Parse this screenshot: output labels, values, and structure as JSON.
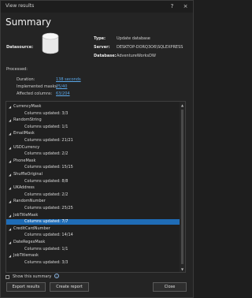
{
  "window": {
    "title": "View results",
    "help_label": "?",
    "close_label": "×"
  },
  "heading": "Summary",
  "datasource": {
    "label": "Datasource:",
    "type_key": "Type:",
    "type_val": "Update database",
    "server_key": "Server:",
    "server_val": "DESKTOP-DORQ3O6\\SQLEXPRESS",
    "database_key": "Database:",
    "database_val": "AdventureWorksDW"
  },
  "processed": {
    "label": "Processed:",
    "stats": [
      {
        "label": "Duration:",
        "value": "138 seconds"
      },
      {
        "label": "Implemented masks:",
        "value": "25/40"
      },
      {
        "label": "Affected columns:",
        "value": "63/204"
      }
    ]
  },
  "tree": {
    "rows": [
      {
        "kind": "group",
        "text": "CurrencyMask"
      },
      {
        "kind": "child",
        "text": "Columns updated: 3/3"
      },
      {
        "kind": "group",
        "text": "RandomString"
      },
      {
        "kind": "child",
        "text": "Columns updated: 1/1"
      },
      {
        "kind": "group",
        "text": "EmailMask"
      },
      {
        "kind": "child",
        "text": "Columns updated: 21/21"
      },
      {
        "kind": "group",
        "text": "USDCurrency"
      },
      {
        "kind": "child",
        "text": "Columns updated: 2/2"
      },
      {
        "kind": "group",
        "text": "PhoneMask"
      },
      {
        "kind": "child",
        "text": "Columns updated: 15/15"
      },
      {
        "kind": "group",
        "text": "ShuffleOriginal"
      },
      {
        "kind": "child",
        "text": "Columns updated: 8/8"
      },
      {
        "kind": "group",
        "text": "UKAddress"
      },
      {
        "kind": "child",
        "text": "Columns updated: 2/2"
      },
      {
        "kind": "group",
        "text": "RandomNumber"
      },
      {
        "kind": "child",
        "text": "Columns updated: 25/25"
      },
      {
        "kind": "group",
        "text": "JobTitleMask"
      },
      {
        "kind": "child",
        "text": "Columns updated: 7/7",
        "selected": true
      },
      {
        "kind": "group",
        "text": "CreditCardNumber"
      },
      {
        "kind": "child",
        "text": "Columns updated: 14/14"
      },
      {
        "kind": "group",
        "text": "DateRegexMask"
      },
      {
        "kind": "child",
        "text": "Columns updated: 1/1"
      },
      {
        "kind": "group",
        "text": "JobTitlemask"
      },
      {
        "kind": "child",
        "text": "Columns updated: 3/3"
      }
    ]
  },
  "footer": {
    "show_summary_label": "Show this summary",
    "info_icon": "i",
    "export_label": "Export results",
    "report_label": "Create report",
    "close_label": "Close"
  }
}
